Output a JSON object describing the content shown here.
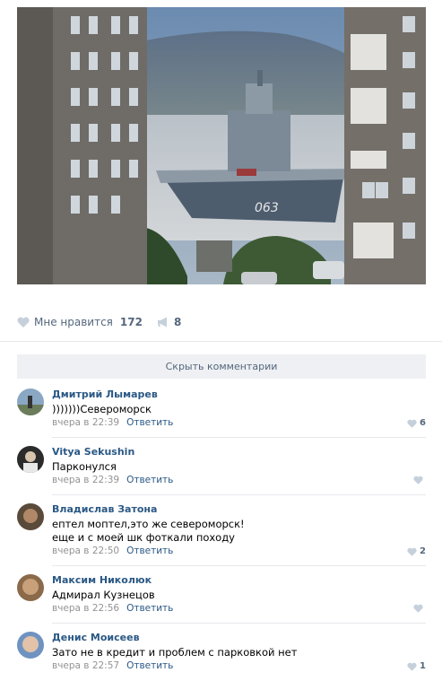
{
  "post": {
    "likes_label": "Мне нравится",
    "likes_count": "172",
    "shares_count": "8",
    "hide_comments_label": "Скрыть комментарии"
  },
  "comments": [
    {
      "author": "Дмитрий Лымарев",
      "text": ")))))))Североморск",
      "time": "вчера в 22:39",
      "reply": "Ответить",
      "likes": "6"
    },
    {
      "author": "Vitya Sekushin",
      "text": "Парконулся",
      "time": "вчера в 22:39",
      "reply": "Ответить",
      "likes": ""
    },
    {
      "author": "Владислав Затона",
      "text": "ептел моптел,это же североморск!\nеще и с моей шк фоткали походу",
      "time": "вчера в 22:50",
      "reply": "Ответить",
      "likes": "2"
    },
    {
      "author": "Максим Николюк",
      "text": "Адмирал Кузнецов",
      "time": "вчера в 22:56",
      "reply": "Ответить",
      "likes": ""
    },
    {
      "author": "Денис Моисеев",
      "text": "Зато не в кредит и проблем с парковкой нет",
      "time": "вчера в 22:57",
      "reply": "Ответить",
      "likes": "1"
    }
  ],
  "colors": {
    "link": "#2a5885",
    "muted": "#939393",
    "action": "#55677d"
  }
}
